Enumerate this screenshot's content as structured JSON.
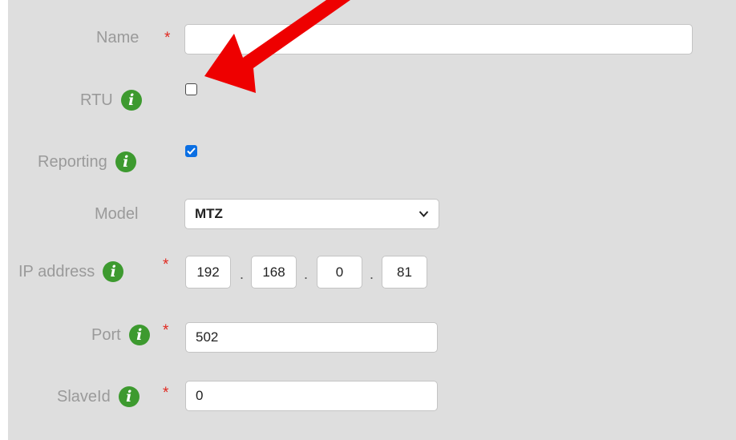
{
  "form": {
    "name": {
      "label": "Name",
      "required": "*",
      "value": ""
    },
    "rtu": {
      "label": "RTU",
      "info_icon": "info-icon",
      "checked": false
    },
    "reporting": {
      "label": "Reporting",
      "info_icon": "info-icon",
      "checked": true
    },
    "model": {
      "label": "Model",
      "selected": "MTZ",
      "dropdown_icon": "chevron-down-icon"
    },
    "ip_address": {
      "label": "IP address",
      "info_icon": "info-icon",
      "required": "*",
      "octets": [
        "192",
        "168",
        "0",
        "81"
      ],
      "separator": "."
    },
    "port": {
      "label": "Port",
      "info_icon": "info-icon",
      "required": "*",
      "value": "502"
    },
    "slave_id": {
      "label": "SlaveId",
      "info_icon": "info-icon",
      "required": "*",
      "value": "0"
    }
  },
  "annotation": {
    "icon": "red-arrow",
    "color": "#ee0000",
    "points_to": "RTU checkbox"
  },
  "colors": {
    "panel": "#dedede",
    "label": "#9a9a9a",
    "required": "#e0281f",
    "info": "#3d9a2f",
    "checkbox_checked": "#0b6fe3"
  },
  "info_glyph": "i"
}
